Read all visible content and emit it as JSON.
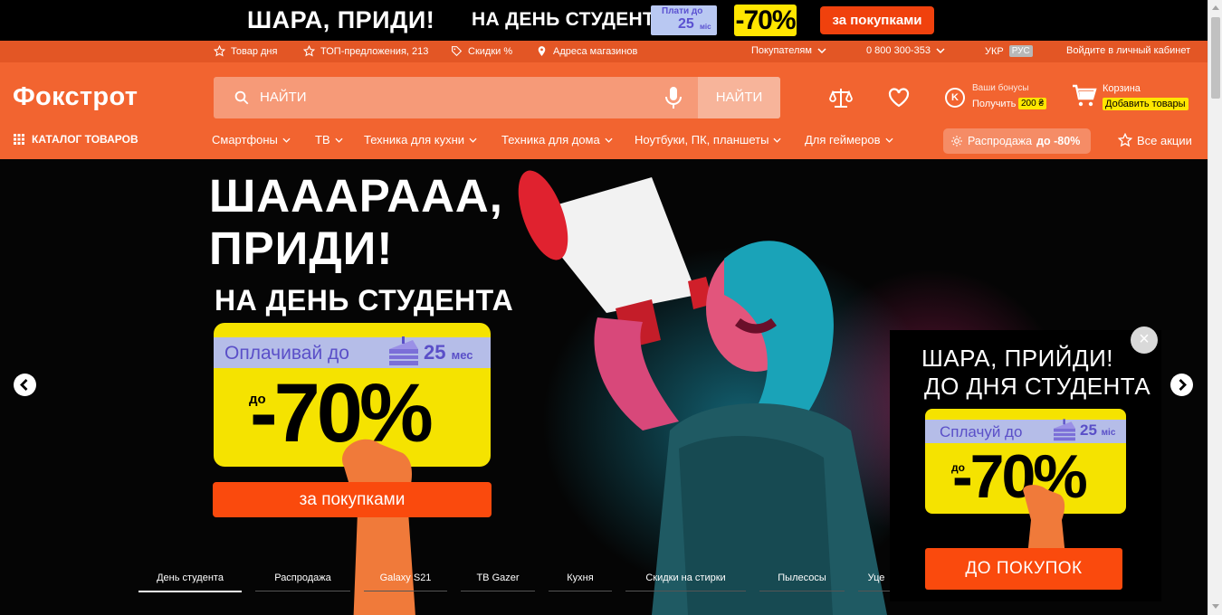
{
  "promo_strip": {
    "headline": "ШАРА, ПРИДИ!",
    "subheadline": "НА ДЕНЬ СТУДЕНТА",
    "pay_badge_line1": "Плати до",
    "pay_badge_months": "25",
    "pay_badge_unit": "міс",
    "discount": "-70%",
    "cta_label": "за покупками"
  },
  "utility_bar": {
    "items": [
      {
        "label": "Товар дня",
        "icon": "star-icon"
      },
      {
        "label": "ТОП-предложения, 213",
        "icon": "star-icon"
      },
      {
        "label": "Скидки %",
        "icon": "tag-icon"
      },
      {
        "label": "Адреса магазинов",
        "icon": "location-pin-icon"
      }
    ],
    "buyers_label": "Покупателям",
    "phone": "0 800 300-353",
    "lang_ukr": "УКР",
    "lang_rus": "РУС",
    "login_label": "Войдите в личный кабинет"
  },
  "header": {
    "logo": "Фокстрот",
    "search_placeholder": "НАЙТИ",
    "search_button": "НАЙТИ",
    "bonus_line1": "Ваши бонусы",
    "bonus_line2": "Получить",
    "bonus_amount": "200 ₴",
    "cart_label": "Корзина",
    "cart_button": "Добавить товары"
  },
  "nav": {
    "catalog_label": "КАТАЛОГ ТОВАРОВ",
    "items": [
      "Смартфоны",
      "ТВ",
      "Техника для кухни",
      "Техника для дома",
      "Ноутбуки, ПК, планшеты",
      "Для геймеров"
    ],
    "sale_prefix": "Распродажа",
    "sale_suffix": "до -80%",
    "all_promos": "Все акции"
  },
  "hero": {
    "title_line1": "ШАААРААА,",
    "title_line2": "ПРИДИ!",
    "subtitle": "НА ДЕНЬ СТУДЕНТА",
    "pay_text": "Оплачивай до",
    "months": "25",
    "months_unit": "мес",
    "do": "до",
    "discount": "-70%",
    "cta_label": "за покупками"
  },
  "slider_tabs": [
    "День студента",
    "Распродажа",
    "Galaxy S21",
    "ТВ Gazer",
    "Кухня",
    "Скидки на стирки",
    "Пылесосы",
    "Уце"
  ],
  "popup": {
    "title_line1": "ШАРА, ПРИЙДИ!",
    "title_line2": "ДО ДНЯ СТУДЕНТА",
    "pay_text": "Сплачуй до",
    "months": "25",
    "months_unit": "міс",
    "do": "до",
    "discount": "-70%",
    "cta_label": "ДО ПОКУПОК",
    "close": "×"
  },
  "colors": {
    "brand_orange": "#f26430",
    "util_orange": "#e35625",
    "cta_red": "#fa4a0d",
    "yellow": "#f5e300",
    "lavender": "#b5bde8"
  }
}
